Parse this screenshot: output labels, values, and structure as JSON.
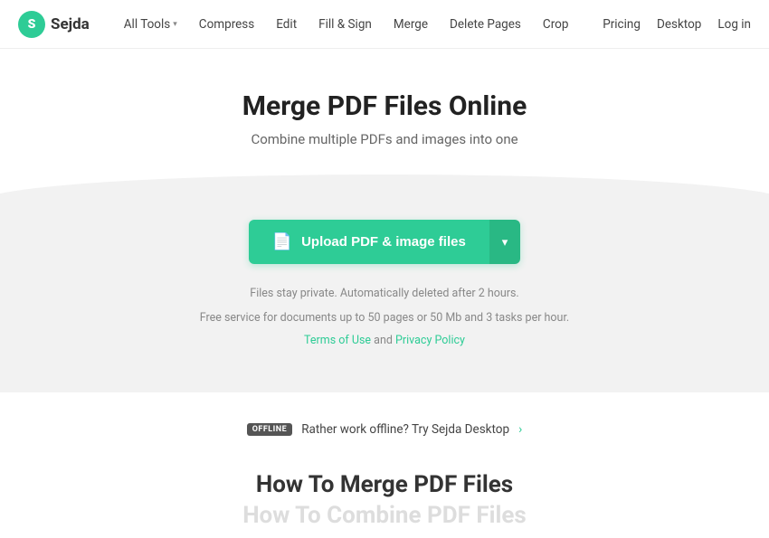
{
  "nav": {
    "logo_letter": "S",
    "logo_name": "Sejda",
    "links": [
      {
        "label": "All Tools",
        "has_dropdown": true
      },
      {
        "label": "Compress",
        "has_dropdown": false
      },
      {
        "label": "Edit",
        "has_dropdown": false
      },
      {
        "label": "Fill & Sign",
        "has_dropdown": false
      },
      {
        "label": "Merge",
        "has_dropdown": false
      },
      {
        "label": "Delete Pages",
        "has_dropdown": false
      },
      {
        "label": "Crop",
        "has_dropdown": false
      }
    ],
    "right_links": [
      "Pricing",
      "Desktop",
      "Log in"
    ]
  },
  "hero": {
    "title": "Merge PDF Files Online",
    "subtitle": "Combine multiple PDFs and images into one"
  },
  "upload": {
    "button_label": "Upload PDF & image files",
    "dropdown_arrow": "▾"
  },
  "info": {
    "line1": "Files stay private. Automatically deleted after 2 hours.",
    "line2": "Free service for documents up to 50 pages or 50 Mb and 3 tasks per hour.",
    "terms_label": "Terms of Use",
    "and_text": " and ",
    "privacy_label": "Privacy Policy"
  },
  "offline": {
    "badge": "OFFLINE",
    "text": "Rather work offline? Try Sejda Desktop",
    "arrow": "›"
  },
  "howto": {
    "title": "How To Merge PDF Files",
    "subtitle": "How To Combine PDF Files"
  }
}
